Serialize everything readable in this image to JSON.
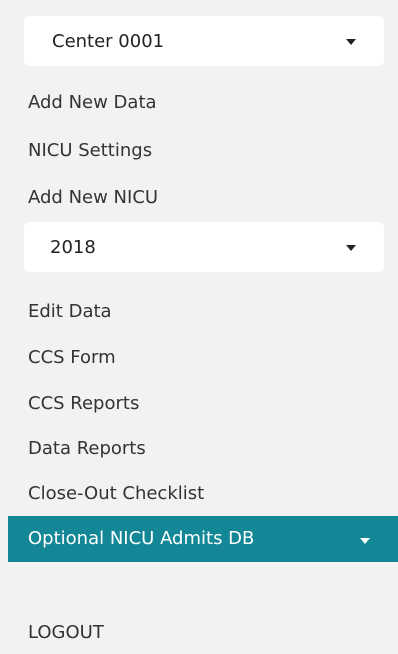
{
  "center_select": {
    "value": "Center 0001",
    "icon": "chevron-down-icon"
  },
  "nav_top": [
    {
      "label": "Add New Data"
    },
    {
      "label": "NICU Settings"
    },
    {
      "label": "Add New NICU"
    }
  ],
  "year_select": {
    "value": "2018",
    "icon": "chevron-down-icon"
  },
  "nav_bottom": [
    {
      "label": "Edit Data"
    },
    {
      "label": "CCS Form"
    },
    {
      "label": "CCS Reports"
    },
    {
      "label": "Data Reports"
    },
    {
      "label": "Close-Out Checklist"
    }
  ],
  "active_item": {
    "label": "Optional NICU Admits DB",
    "icon": "chevron-down-icon"
  },
  "logout": {
    "label": "LOGOUT"
  },
  "colors": {
    "background": "#f2f2f2",
    "active_background": "#138796",
    "active_text": "#ffffff",
    "text": "#333333"
  }
}
